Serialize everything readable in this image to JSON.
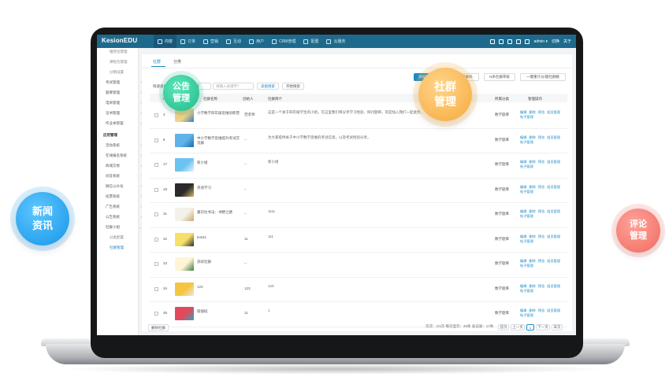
{
  "app": {
    "logo": "KesionEDU"
  },
  "topnav": {
    "items": [
      "内容",
      "订单",
      "营销",
      "互动",
      "用户",
      "CRM管理",
      "配置",
      "云服务"
    ],
    "right": [
      "admin ▾",
      "切换",
      "关于"
    ]
  },
  "sidebar": {
    "top_items": [
      "推荐位管理",
      "课程包管理",
      "分销设置"
    ],
    "groups": [
      "考试管理",
      "题库管理",
      "电商管理",
      "证书管理",
      "作业本管理"
    ],
    "section_title": "应用管理",
    "apps": [
      "活动系统",
      "在线报名系统",
      "商城交易",
      "问答系统",
      "微信公众号",
      "投票系统",
      "广告系统",
      "公告系统",
      "社群小组"
    ],
    "sub_items": [
      "分类配置",
      "社群管理"
    ]
  },
  "tabs": [
    "社群",
    "分类"
  ],
  "toolbar": {
    "add": "添加社群",
    "btn2": "一键批量删除",
    "btn3": "N条社群审核",
    "btn4": "一键重计分/题社群数"
  },
  "filter": {
    "label": "快速查找",
    "select": "名称",
    "placeholder": "请输入关键字？",
    "adv": "高级搜索",
    "search": "开始搜索"
  },
  "columns": [
    "",
    "ID",
    "社群名称",
    "创始人",
    "社群简介",
    "所属分类",
    "管理操作"
  ],
  "rows": [
    {
      "id": "4",
      "name": "小学数学四年级思维训练营",
      "founder": "范老师",
      "intro": "这是一个关于四年级学生的小组，在这里我们将分享学习经验、探讨题目，欢迎加入我们一起进步。",
      "cat": "数学题库",
      "c1": "#f3d48a",
      "c2": "#2a7fc0"
    },
    {
      "id": "8",
      "name": "中小学数学思维提升考试交流群",
      "founder": "--",
      "intro": "为大家提供关于中小学数学思维的考试信息，以及考试经验分享。",
      "cat": "数学题库",
      "c1": "#5fb3e8",
      "c2": "#1d6aa8"
    },
    {
      "id": "17",
      "name": "新小组",
      "founder": "--",
      "intro": "新小组",
      "cat": "数学题库",
      "c1": "#6cc3f0",
      "c2": "#e8f4fb"
    },
    {
      "id": "18",
      "name": "英语学习",
      "founder": "--",
      "intro": "",
      "cat": "数学题库",
      "c1": "#2a2a2a",
      "c2": "#d9b46a"
    },
    {
      "id": "31",
      "name": "趣识达书法：书野之路",
      "founder": "--",
      "intro": "1111",
      "cat": "数学题库",
      "c1": "#f4f1ea",
      "c2": "#c9a66b"
    },
    {
      "id": "32",
      "name": "test11",
      "founder": "11",
      "intro": "111",
      "cat": "数学题库",
      "c1": "#f7e06a",
      "c2": "#2e2e2e"
    },
    {
      "id": "33",
      "name": "测试社群",
      "founder": "--",
      "intro": "",
      "cat": "数学题库",
      "c1": "#fff4d6",
      "c2": "#3a7d3a"
    },
    {
      "id": "34",
      "name": "123",
      "founder": "123",
      "intro": "123",
      "cat": "数学题库",
      "c1": "#f5c542",
      "c2": "#e9e9e9"
    },
    {
      "id": "35",
      "name": "瑜伽班",
      "founder": "11",
      "intro": "1",
      "cat": "数学题库",
      "c1": "#e04a5c",
      "c2": "#2fa3c9"
    }
  ],
  "ops": {
    "edit": "编辑",
    "del": "删除",
    "preview": "预览",
    "members": "组员管理",
    "posts": "帖子管理"
  },
  "footer": {
    "delete": "删除社群",
    "pageinfo": "页次：1/1页 每页显示：20条 总记录：17条",
    "first": "首页",
    "prev": "上一页",
    "page": "1",
    "next": "下一页",
    "last": "末页"
  },
  "bubbles": {
    "notice": [
      "公告",
      "管理"
    ],
    "community": [
      "社群",
      "管理"
    ],
    "news": [
      "新闻",
      "资讯"
    ],
    "comment": [
      "评论",
      "管理"
    ]
  }
}
